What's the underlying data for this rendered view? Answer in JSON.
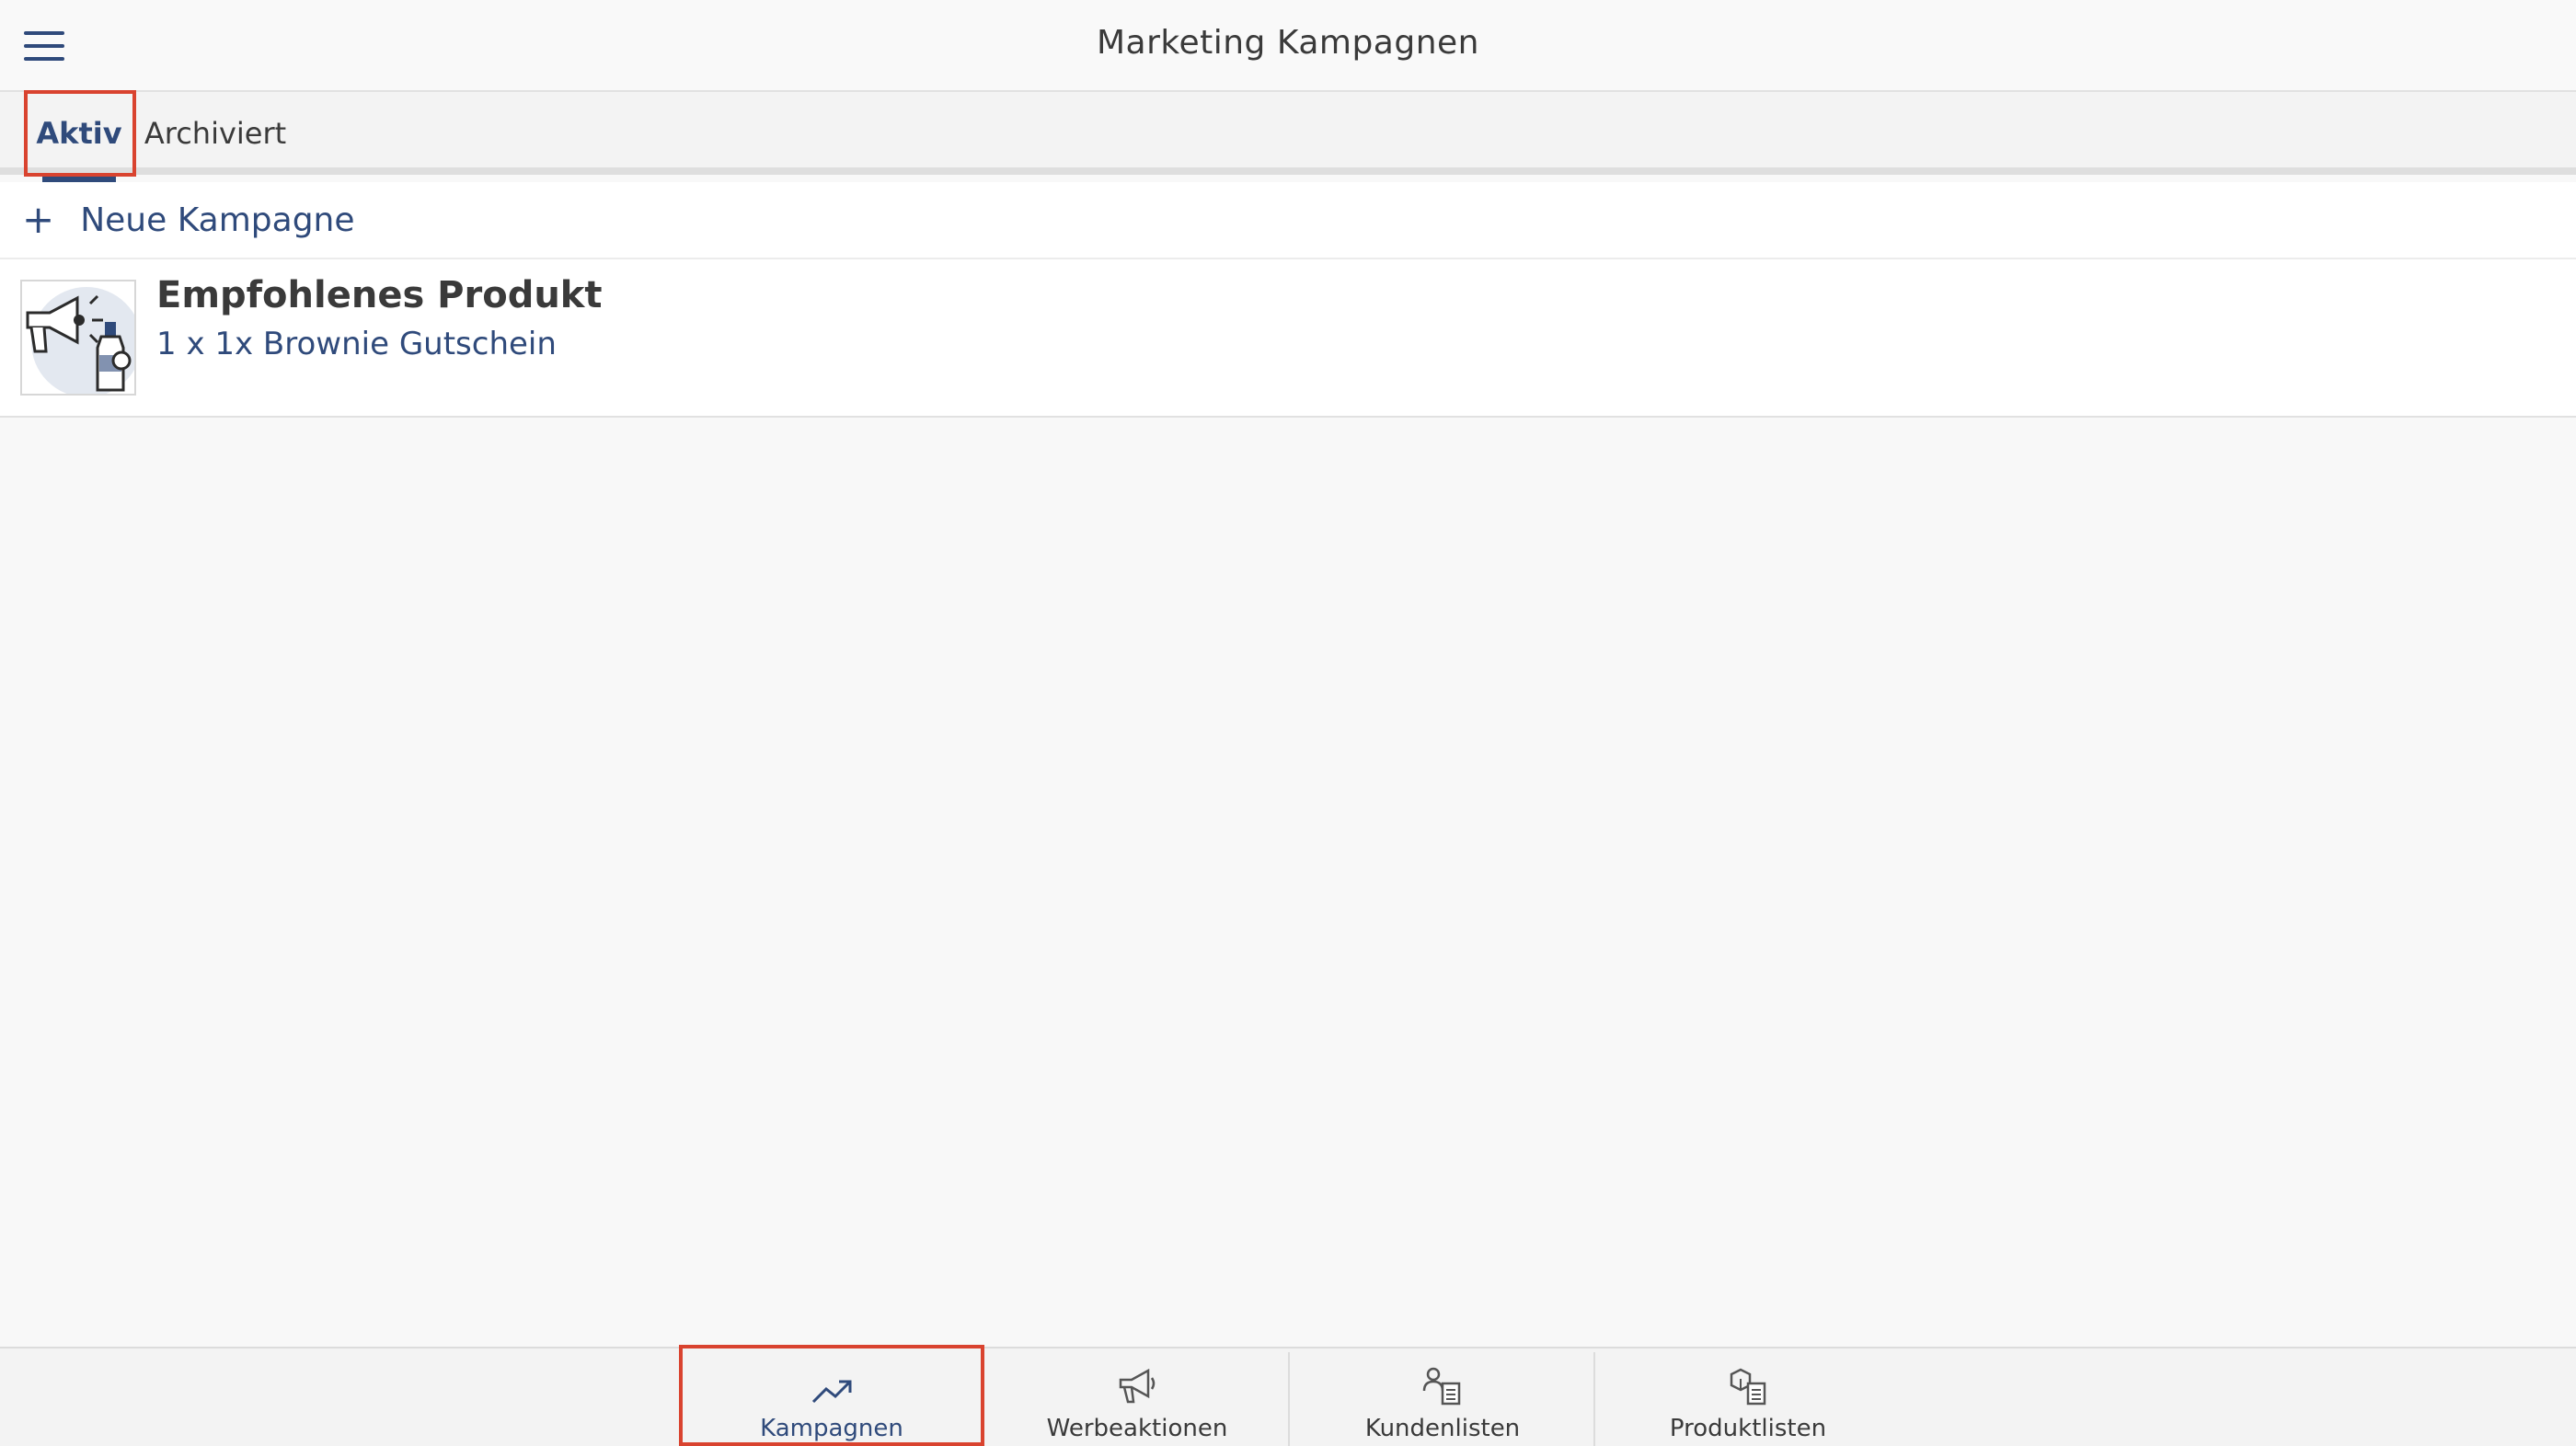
{
  "header": {
    "title": "Marketing Kampagnen",
    "menu_icon": "hamburger-menu-icon"
  },
  "tabs": [
    {
      "label": "Aktiv",
      "selected": true
    },
    {
      "label": "Archiviert",
      "selected": false
    }
  ],
  "new_campaign": {
    "label": "Neue Kampagne",
    "icon": "plus-icon"
  },
  "campaigns": [
    {
      "title": "Empfohlenes Produkt",
      "subtitle": "1 x 1x Brownie Gutschein",
      "icon": "megaphone-bottle-icon"
    }
  ],
  "bottom_nav": [
    {
      "label": "Kampagnen",
      "icon": "trending-up-icon",
      "active": true
    },
    {
      "label": "Werbeaktionen",
      "icon": "megaphone-icon",
      "active": false
    },
    {
      "label": "Kundenlisten",
      "icon": "customer-list-icon",
      "active": false
    },
    {
      "label": "Produktlisten",
      "icon": "product-list-icon",
      "active": false
    }
  ],
  "colors": {
    "accent": "#2f4a7b",
    "highlight": "#d9432f",
    "background": "#f8f8f8"
  }
}
